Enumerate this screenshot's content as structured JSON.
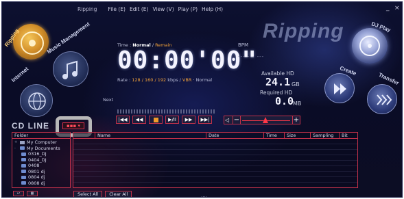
{
  "window": {
    "title": "Ripping",
    "minimize": "_",
    "close": "×"
  },
  "menu": [
    {
      "label": "File (E)"
    },
    {
      "label": "Edit (E)"
    },
    {
      "label": "View (V)"
    },
    {
      "label": "Play (P)"
    },
    {
      "label": "Help (H)"
    }
  ],
  "brand": "Ripping",
  "modes": [
    {
      "label": "Ripping"
    },
    {
      "label": "Music Management"
    },
    {
      "label": "Internet"
    }
  ],
  "right_buttons": [
    {
      "label": "DJ Play"
    },
    {
      "label": "Create"
    },
    {
      "label": "Transfer"
    }
  ],
  "time": {
    "caption_prefix": "Time :",
    "normal": "Normal",
    "sep": " / ",
    "remain": "Remain",
    "digits": "00:00'00\""
  },
  "rate": {
    "prefix": "Rate :",
    "values": "128 / 160 / 192",
    "suffix": " kbps / ",
    "mode": "VBR",
    "tail": " · Normal"
  },
  "next_label": "Next",
  "bpm": {
    "label": "BPM",
    "value": "---  ---  ---"
  },
  "hd": {
    "available_label": "Available HD",
    "available_value": "24.1",
    "available_unit": "GB",
    "required_label": "Required HD",
    "required_value": "0.0",
    "required_unit": "MB"
  },
  "transport": {
    "prev": "|◀◀",
    "rewind": "◀◀",
    "play_pause": "▶/II",
    "forward": "▶▶",
    "next": "▶▶|"
  },
  "volume": {
    "speaker": "◁",
    "minus": "−",
    "plus": "+"
  },
  "cd_line": "CD  LINE",
  "cd_indicator": "▪▪▪ ▾",
  "folder_panel": {
    "header": "Folder",
    "items": [
      {
        "label": "My Computer"
      },
      {
        "label": "My Documents"
      },
      {
        "label": "0316_DJ"
      },
      {
        "label": "0404_DJ"
      },
      {
        "label": "0408"
      },
      {
        "label": "0801 dj"
      },
      {
        "label": "0804 dj"
      },
      {
        "label": "0808 dj"
      }
    ]
  },
  "list_panel": {
    "columns": [
      {
        "label": ""
      },
      {
        "label": "Name"
      },
      {
        "label": "Date"
      },
      {
        "label": "Time"
      },
      {
        "label": "Size"
      },
      {
        "label": "Sampling"
      },
      {
        "label": "Bit"
      }
    ]
  },
  "buttons": {
    "select_all": "Select All",
    "clear_all": "Clear All"
  },
  "drag_handle": "····"
}
